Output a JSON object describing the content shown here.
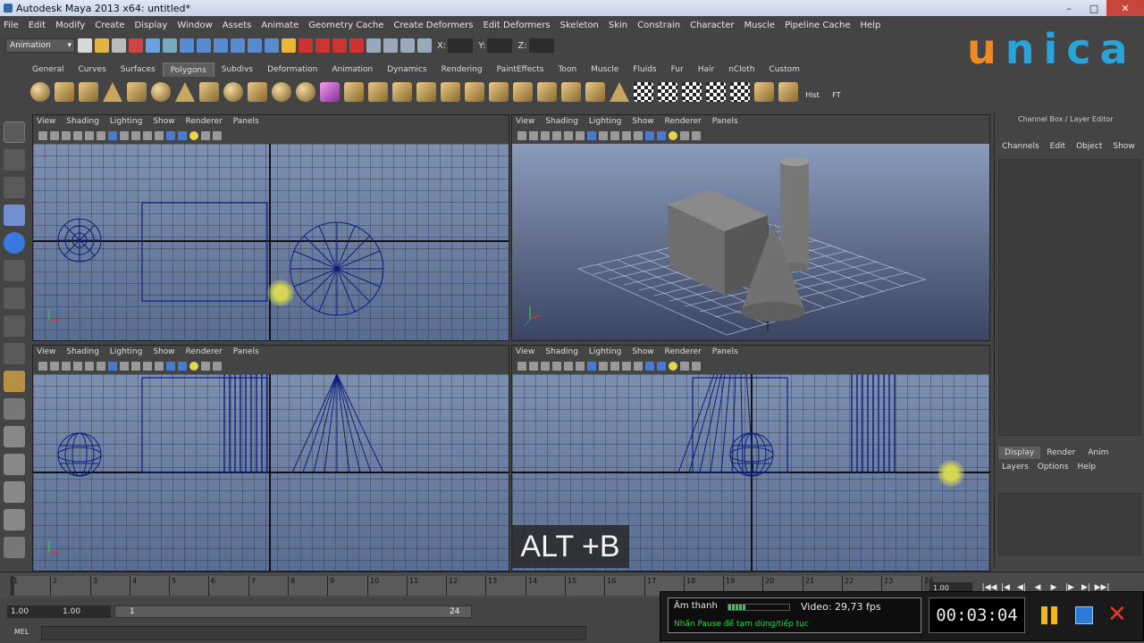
{
  "window": {
    "title": "Autodesk Maya 2013 x64: untitled*"
  },
  "menu": [
    "File",
    "Edit",
    "Modify",
    "Create",
    "Display",
    "Window",
    "Assets",
    "Animate",
    "Geometry Cache",
    "Create Deformers",
    "Edit Deformers",
    "Skeleton",
    "Skin",
    "Constrain",
    "Character",
    "Muscle",
    "Pipeline Cache",
    "Help"
  ],
  "status": {
    "mode": "Animation",
    "x_label": "X:",
    "y_label": "Y:",
    "z_label": "Z:"
  },
  "logo": {
    "first": "u",
    "rest": "nica"
  },
  "shelf": {
    "tabs": [
      "General",
      "Curves",
      "Surfaces",
      "Polygons",
      "Subdivs",
      "Deformation",
      "Animation",
      "Dynamics",
      "Rendering",
      "PaintEffects",
      "Toon",
      "Muscle",
      "Fluids",
      "Fur",
      "Hair",
      "nCloth",
      "Custom"
    ],
    "active_tab": "Polygons",
    "labels": {
      "hist": "Hist",
      "ft": "FT"
    }
  },
  "viewport_menu": [
    "View",
    "Shading",
    "Lighting",
    "Show",
    "Renderer",
    "Panels"
  ],
  "channel_box": {
    "title": "Channel Box / Layer Editor",
    "menu": [
      "Channels",
      "Edit",
      "Object",
      "Show"
    ],
    "layer_tabs": [
      "Display",
      "Render",
      "Anim"
    ],
    "active_layer_tab": "Display",
    "layer_menu": [
      "Layers",
      "Options",
      "Help"
    ]
  },
  "timeline": {
    "start": 1,
    "end": 24,
    "ticks": [
      "1",
      "2",
      "3",
      "4",
      "5",
      "6",
      "7",
      "8",
      "9",
      "10",
      "11",
      "12",
      "13",
      "14",
      "15",
      "16",
      "17",
      "18",
      "19",
      "20",
      "21",
      "22",
      "23",
      "24"
    ],
    "current_time": "1.00"
  },
  "range": {
    "start_time": "1.00",
    "start_range": "1.00",
    "range_low": "1",
    "range_high": "24"
  },
  "command_line": {
    "label": "MEL"
  },
  "player": {
    "sound_label": "Âm thanh",
    "sound_level": 0.3,
    "fps": "Video: 29,73 fps",
    "hint": "Nhấn Pause để tạm dừng/tiếp tục",
    "time": "00:03:04"
  },
  "caption": "ALT +B",
  "colors": {
    "wire": "#0d1f7a",
    "viewport_bg": "#6a7ea3",
    "accent_logo_u": "#f08a24",
    "accent_logo": "#2aa3d8"
  }
}
